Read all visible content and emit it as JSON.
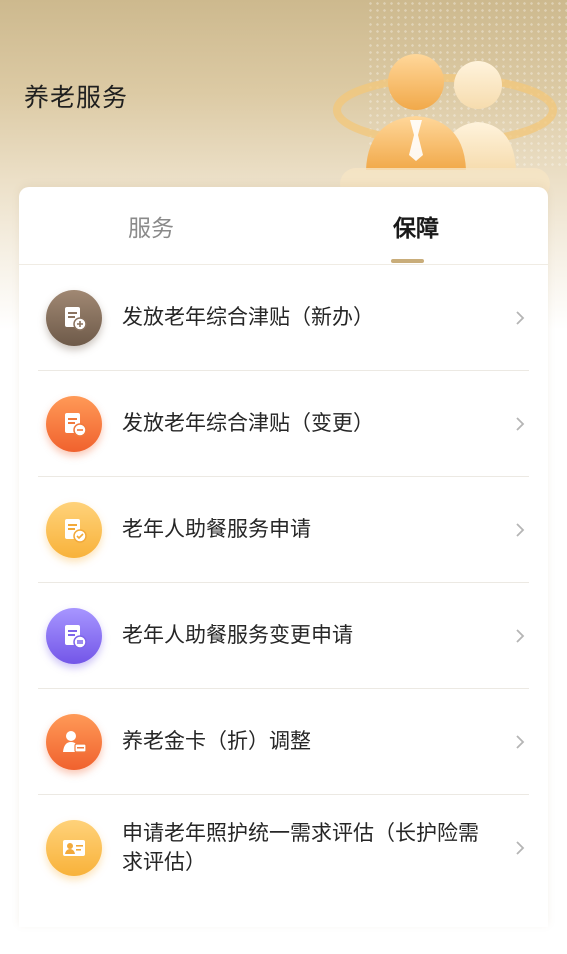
{
  "header": {
    "title": "养老服务"
  },
  "tabs": [
    {
      "label": "服务",
      "active": false
    },
    {
      "label": "保障",
      "active": true
    }
  ],
  "items": [
    {
      "label": "发放老年综合津贴（新办）",
      "icon": "document-add-icon",
      "color_from": "#a08873",
      "color_to": "#6e5a49"
    },
    {
      "label": "发放老年综合津贴（变更）",
      "icon": "document-edit-icon",
      "color_from": "#ff9a57",
      "color_to": "#f0622e"
    },
    {
      "label": "老年人助餐服务申请",
      "icon": "document-check-icon",
      "color_from": "#ffd27a",
      "color_to": "#f8b23a"
    },
    {
      "label": "老年人助餐服务变更申请",
      "icon": "document-swap-icon",
      "color_from": "#a796ff",
      "color_to": "#7356e8"
    },
    {
      "label": "养老金卡（折）调整",
      "icon": "person-card-icon",
      "color_from": "#ff9a57",
      "color_to": "#f0622e"
    },
    {
      "label": "申请老年照护统一需求评估（长护险需求评估）",
      "icon": "photo-id-icon",
      "color_from": "#ffd27a",
      "color_to": "#f8b23a"
    }
  ],
  "colors": {
    "accent": "#c9ad7a",
    "text": "#262626",
    "tab_inactive": "#8a8a8a"
  }
}
